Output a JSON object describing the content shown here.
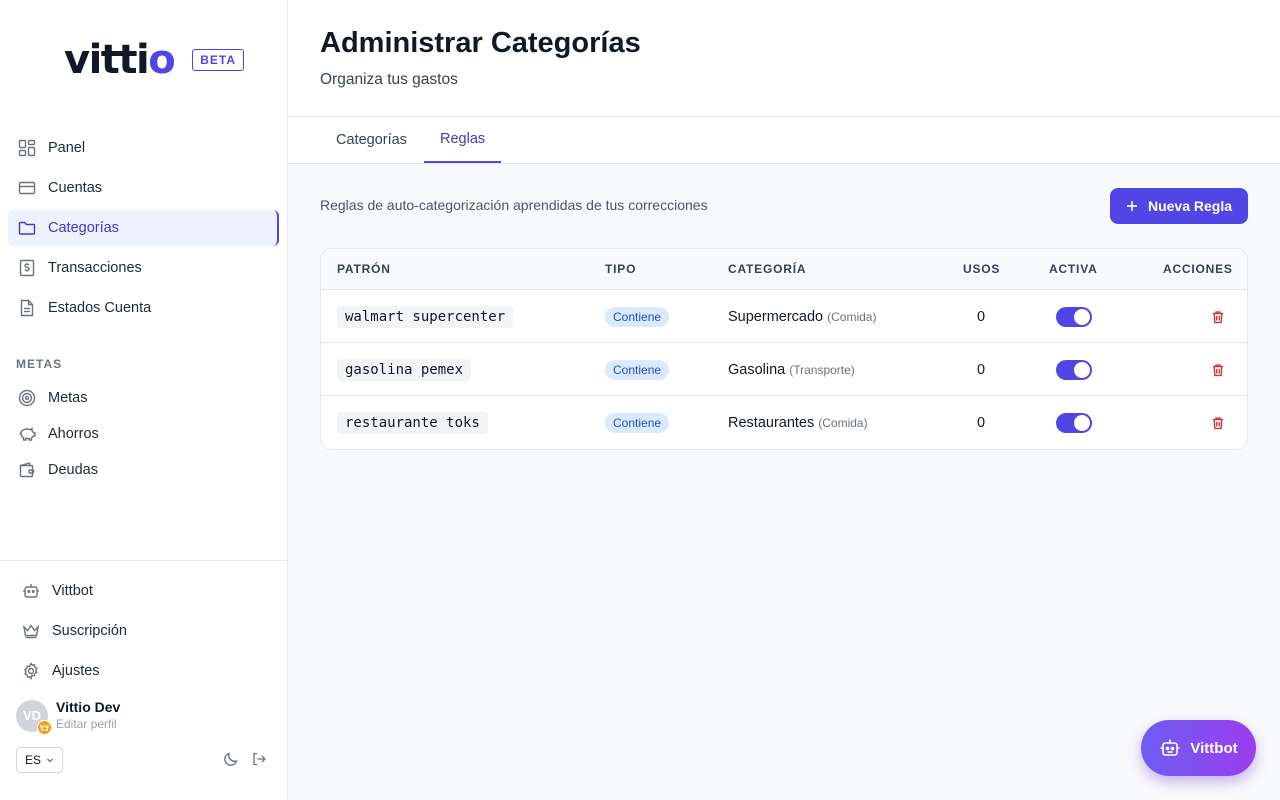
{
  "brand": {
    "logo_main": "vitti",
    "logo_accent": "o",
    "badge": "BETA"
  },
  "nav": {
    "items": [
      {
        "label": "Panel",
        "icon": "dashboard-icon"
      },
      {
        "label": "Cuentas",
        "icon": "credit-card-icon"
      },
      {
        "label": "Categorías",
        "icon": "folder-icon",
        "active": true
      },
      {
        "label": "Transacciones",
        "icon": "dollar-receipt-icon"
      },
      {
        "label": "Estados Cuenta",
        "icon": "document-icon"
      }
    ],
    "section_label": "METAS",
    "goals_items": [
      {
        "label": "Metas",
        "icon": "target-icon"
      },
      {
        "label": "Ahorros",
        "icon": "piggy-bank-icon"
      },
      {
        "label": "Deudas",
        "icon": "wallet-icon"
      }
    ],
    "bottom_items": [
      {
        "label": "Vittbot",
        "icon": "bot-icon"
      },
      {
        "label": "Suscripción",
        "icon": "crown-icon"
      },
      {
        "label": "Ajustes",
        "icon": "gear-icon"
      }
    ]
  },
  "user": {
    "initials": "VD",
    "name": "Vittio Dev",
    "edit_label": "Editar perfil"
  },
  "language": "ES",
  "header": {
    "title": "Administrar Categorías",
    "subtitle": "Organiza tus gastos"
  },
  "tabs": [
    {
      "label": "Categorías",
      "active": false
    },
    {
      "label": "Reglas",
      "active": true
    }
  ],
  "rules": {
    "description": "Reglas de auto-categorización aprendidas de tus correcciones",
    "new_button": "Nueva Regla",
    "columns": [
      "PATRÓN",
      "TIPO",
      "CATEGORÍA",
      "USOS",
      "ACTIVA",
      "ACCIONES"
    ],
    "rows": [
      {
        "pattern": "walmart supercenter",
        "type": "Contiene",
        "category": "Supermercado",
        "parent": "(Comida)",
        "uses": "0",
        "active": true
      },
      {
        "pattern": "gasolina pemex",
        "type": "Contiene",
        "category": "Gasolina",
        "parent": "(Transporte)",
        "uses": "0",
        "active": true
      },
      {
        "pattern": "restaurante toks",
        "type": "Contiene",
        "category": "Restaurantes",
        "parent": "(Comida)",
        "uses": "0",
        "active": true
      }
    ]
  },
  "fab": {
    "label": "Vittbot"
  },
  "colors": {
    "accent": "#4f46e5",
    "danger": "#dc2626",
    "badge_bg": "#dbeafe"
  }
}
